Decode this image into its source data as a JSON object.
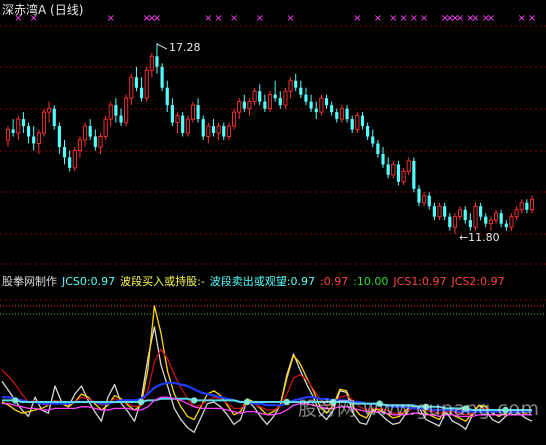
{
  "header": {
    "title": "深赤湾A (日线)"
  },
  "colors": {
    "background": "#000000",
    "grid": "#8b0000",
    "up_candle": "#ff3333",
    "down_candle": "#54ffff",
    "marker": "#ff40ff",
    "white_line": "#d8d8d8",
    "yellow_line": "#ffd400",
    "blue_line": "#1f3cff",
    "cyan_line": "#5ad8e8",
    "magenta_line": "#ff44ff",
    "red_line": "#c81414"
  },
  "indicator_bar": {
    "items": [
      {
        "text": "股拳网制作",
        "color": "#dcdcdc"
      },
      {
        "text": "JCS0:0.97",
        "color": "#54ffff"
      },
      {
        "text": "波段买入或持股:-",
        "color": "#ffff55"
      },
      {
        "text": "波段卖出或观望:0.97",
        "color": "#54ffff"
      },
      {
        "text": ":0.97",
        "color": "#ff4444"
      },
      {
        "text": ":10.00",
        "color": "#33dd33"
      },
      {
        "text": "JCS1:0.97",
        "color": "#ff4444"
      },
      {
        "text": "JCS2:0.97",
        "color": "#ff4444"
      }
    ]
  },
  "watermark": "股旁网 www.gupang.com",
  "chart_data": [
    {
      "type": "candlestick",
      "title": "深赤湾A (日线)",
      "annotations": [
        {
          "text": "17.28",
          "kind": "high"
        },
        {
          "text": "←11.80",
          "kind": "low"
        }
      ],
      "ylim": [
        11.0,
        18.0
      ],
      "candles": [
        [
          14.5,
          14.9,
          14.3,
          14.8
        ],
        [
          14.8,
          15.1,
          14.6,
          14.7
        ],
        [
          14.7,
          15.2,
          14.5,
          15.1
        ],
        [
          15.1,
          15.3,
          14.7,
          14.9
        ],
        [
          14.9,
          15.0,
          14.4,
          14.6
        ],
        [
          14.6,
          14.9,
          14.2,
          14.4
        ],
        [
          14.4,
          14.8,
          14.1,
          14.7
        ],
        [
          14.7,
          15.4,
          14.6,
          15.3
        ],
        [
          15.3,
          15.6,
          15.0,
          15.4
        ],
        [
          15.4,
          15.5,
          14.8,
          14.9
        ],
        [
          14.9,
          15.0,
          14.1,
          14.3
        ],
        [
          14.3,
          14.5,
          13.8,
          14.0
        ],
        [
          14.0,
          14.2,
          13.6,
          13.7
        ],
        [
          13.7,
          14.3,
          13.6,
          14.2
        ],
        [
          14.2,
          14.6,
          14.0,
          14.5
        ],
        [
          14.5,
          15.0,
          14.3,
          14.9
        ],
        [
          14.9,
          15.1,
          14.5,
          14.6
        ],
        [
          14.6,
          14.8,
          14.2,
          14.3
        ],
        [
          14.3,
          14.7,
          14.1,
          14.6
        ],
        [
          14.6,
          15.2,
          14.5,
          15.1
        ],
        [
          15.1,
          15.6,
          14.9,
          15.5
        ],
        [
          15.5,
          15.7,
          15.0,
          15.2
        ],
        [
          15.2,
          15.4,
          14.9,
          15.0
        ],
        [
          15.0,
          15.8,
          14.9,
          15.7
        ],
        [
          15.7,
          16.4,
          15.5,
          16.3
        ],
        [
          16.3,
          16.6,
          15.9,
          16.0
        ],
        [
          16.0,
          16.3,
          15.6,
          15.7
        ],
        [
          15.7,
          16.6,
          15.6,
          16.5
        ],
        [
          16.5,
          17.0,
          16.3,
          16.9
        ],
        [
          16.9,
          17.28,
          16.4,
          16.6
        ],
        [
          16.6,
          16.7,
          15.9,
          16.0
        ],
        [
          16.0,
          16.2,
          15.3,
          15.5
        ],
        [
          15.5,
          15.7,
          14.9,
          15.0
        ],
        [
          15.0,
          15.3,
          14.7,
          15.2
        ],
        [
          15.2,
          15.3,
          14.6,
          14.7
        ],
        [
          14.7,
          15.2,
          14.6,
          15.1
        ],
        [
          15.1,
          15.6,
          15.0,
          15.5
        ],
        [
          15.5,
          15.7,
          15.0,
          15.1
        ],
        [
          15.1,
          15.2,
          14.5,
          14.6
        ],
        [
          14.6,
          15.0,
          14.4,
          14.9
        ],
        [
          14.9,
          15.1,
          14.6,
          14.7
        ],
        [
          14.7,
          15.0,
          14.5,
          14.9
        ],
        [
          14.9,
          15.0,
          14.5,
          14.6
        ],
        [
          14.6,
          15.0,
          14.5,
          14.9
        ],
        [
          14.9,
          15.4,
          14.8,
          15.3
        ],
        [
          15.3,
          15.7,
          15.1,
          15.6
        ],
        [
          15.6,
          15.8,
          15.3,
          15.4
        ],
        [
          15.4,
          15.7,
          15.2,
          15.6
        ],
        [
          15.6,
          16.0,
          15.5,
          15.9
        ],
        [
          15.9,
          16.1,
          15.5,
          15.6
        ],
        [
          15.6,
          15.8,
          15.3,
          15.4
        ],
        [
          15.4,
          15.9,
          15.3,
          15.8
        ],
        [
          15.8,
          16.2,
          15.6,
          15.7
        ],
        [
          15.7,
          15.9,
          15.4,
          15.5
        ],
        [
          15.5,
          16.0,
          15.4,
          15.9
        ],
        [
          15.9,
          16.3,
          15.7,
          16.2
        ],
        [
          16.2,
          16.4,
          15.9,
          16.0
        ],
        [
          16.0,
          16.2,
          15.7,
          15.8
        ],
        [
          15.8,
          16.0,
          15.5,
          15.6
        ],
        [
          15.6,
          15.8,
          15.3,
          15.4
        ],
        [
          15.4,
          15.6,
          15.1,
          15.3
        ],
        [
          15.3,
          15.8,
          15.2,
          15.7
        ],
        [
          15.7,
          15.8,
          15.4,
          15.5
        ],
        [
          15.5,
          15.6,
          15.2,
          15.3
        ],
        [
          15.3,
          15.4,
          15.0,
          15.1
        ],
        [
          15.1,
          15.5,
          15.0,
          15.4
        ],
        [
          15.4,
          15.5,
          15.0,
          15.1
        ],
        [
          15.1,
          15.2,
          14.7,
          14.8
        ],
        [
          14.8,
          15.3,
          14.7,
          15.2
        ],
        [
          15.2,
          15.3,
          14.8,
          14.9
        ],
        [
          14.9,
          15.0,
          14.5,
          14.6
        ],
        [
          14.6,
          14.8,
          14.3,
          14.4
        ],
        [
          14.4,
          14.5,
          14.0,
          14.1
        ],
        [
          14.1,
          14.3,
          13.7,
          13.8
        ],
        [
          13.8,
          14.0,
          13.4,
          13.5
        ],
        [
          13.5,
          13.9,
          13.4,
          13.8
        ],
        [
          13.8,
          13.9,
          13.2,
          13.3
        ],
        [
          13.3,
          13.7,
          13.2,
          13.6
        ],
        [
          13.6,
          14.0,
          13.5,
          13.9
        ],
        [
          13.9,
          14.0,
          13.0,
          13.1
        ],
        [
          13.1,
          13.2,
          12.6,
          12.7
        ],
        [
          12.7,
          13.0,
          12.6,
          12.9
        ],
        [
          12.9,
          13.0,
          12.5,
          12.6
        ],
        [
          12.6,
          12.7,
          12.2,
          12.3
        ],
        [
          12.3,
          12.7,
          12.2,
          12.6
        ],
        [
          12.6,
          12.7,
          12.2,
          12.3
        ],
        [
          12.3,
          12.4,
          11.9,
          12.0
        ],
        [
          12.0,
          12.4,
          11.8,
          12.3
        ],
        [
          12.3,
          12.6,
          12.2,
          12.5
        ],
        [
          12.5,
          12.6,
          12.1,
          12.2
        ],
        [
          12.2,
          12.4,
          11.9,
          12.0
        ],
        [
          12.0,
          12.7,
          11.9,
          12.6
        ],
        [
          12.6,
          12.7,
          12.2,
          12.3
        ],
        [
          12.3,
          12.4,
          12.0,
          12.1
        ],
        [
          12.1,
          12.3,
          11.9,
          12.2
        ],
        [
          12.2,
          12.5,
          12.1,
          12.4
        ],
        [
          12.4,
          12.5,
          12.0,
          12.1
        ],
        [
          12.1,
          12.2,
          11.9,
          12.0
        ],
        [
          12.0,
          12.4,
          11.9,
          12.3
        ],
        [
          12.3,
          12.6,
          12.2,
          12.5
        ],
        [
          12.5,
          12.8,
          12.4,
          12.7
        ],
        [
          12.7,
          12.8,
          12.4,
          12.5
        ],
        [
          12.5,
          12.9,
          12.4,
          12.8
        ]
      ],
      "markers_at_index": [
        2,
        5,
        20,
        27,
        28,
        29,
        39,
        41,
        44,
        49,
        55,
        68,
        72,
        75,
        77,
        79,
        81,
        85,
        86,
        87,
        88,
        90,
        91,
        93,
        94,
        100,
        102
      ]
    },
    {
      "type": "line",
      "title": "JCS",
      "ylim": [
        0,
        10
      ],
      "dotted_levels": [
        8.5,
        8.0
      ],
      "series": [
        {
          "name": "JCS0",
          "color": "#d8d8d8",
          "values": [
            3.8,
            3.2,
            2.6,
            2.0,
            1.6,
            2.8,
            2.0,
            1.8,
            3.5,
            2.5,
            2.2,
            3.0,
            3.5,
            2.6,
            1.9,
            1.3,
            2.8,
            3.6,
            2.4,
            1.9,
            1.3,
            2.6,
            5.2,
            7.2,
            4.8,
            3.5,
            2.1,
            1.4,
            0.9,
            0.6,
            1.5,
            2.4,
            2.5,
            2.2,
            1.7,
            1.1,
            1.4,
            2.6,
            2.2,
            1.6,
            1.1,
            1.6,
            2.3,
            4.2,
            5.5,
            4.5,
            3.6,
            2.8,
            1.8,
            1.4,
            2.0,
            3.2,
            3.1,
            1.8,
            1.2,
            1.1,
            2.0,
            1.8,
            1.4,
            1.1,
            1.2,
            1.8,
            2.2,
            2.1,
            1.4,
            1.2,
            1.0,
            1.9,
            1.3,
            1.1,
            0.8,
            1.7,
            2.3,
            2.0,
            1.4,
            1.2,
            1.6,
            1.9,
            1.8,
            1.5,
            1.3
          ]
        },
        {
          "name": "JCS1",
          "color": "#ffd400",
          "values": [
            2.5,
            2.3,
            2.0,
            1.8,
            1.9,
            2.0,
            2.1,
            2.3,
            2.6,
            2.4,
            2.2,
            2.5,
            3.0,
            2.8,
            2.4,
            2.0,
            2.3,
            2.9,
            2.7,
            2.3,
            2.0,
            2.3,
            4.5,
            8.5,
            6.8,
            4.4,
            3.0,
            2.2,
            1.6,
            1.4,
            2.2,
            3.0,
            3.2,
            2.9,
            2.3,
            1.7,
            1.9,
            2.7,
            2.5,
            2.1,
            1.7,
            1.9,
            2.3,
            4.0,
            5.4,
            4.9,
            4.0,
            3.2,
            2.2,
            1.8,
            2.3,
            3.3,
            3.2,
            2.2,
            1.7,
            1.5,
            2.1,
            2.0,
            1.8,
            1.5,
            1.6,
            2.0,
            2.3,
            2.2,
            1.8,
            1.6,
            1.4,
            2.1,
            1.7,
            1.5,
            1.3,
            1.8,
            2.3,
            2.2,
            1.8,
            1.6,
            1.8,
            2.0,
            1.9,
            1.8,
            1.9
          ]
        },
        {
          "name": "JCS2",
          "color": "#c81414",
          "values": [
            4.5,
            4.1,
            3.6,
            3.0,
            2.5,
            2.6,
            2.4,
            2.3,
            2.6,
            2.5,
            2.4,
            2.5,
            2.8,
            2.7,
            2.5,
            2.3,
            2.4,
            2.7,
            2.6,
            2.4,
            2.2,
            2.3,
            3.2,
            5.0,
            5.8,
            5.2,
            4.2,
            3.4,
            2.7,
            2.2,
            2.3,
            2.6,
            2.8,
            2.7,
            2.4,
            2.1,
            2.1,
            2.4,
            2.4,
            2.2,
            2.0,
            2.0,
            2.2,
            3.0,
            4.0,
            4.2,
            3.9,
            3.3,
            2.7,
            2.3,
            2.4,
            2.8,
            2.9,
            2.6,
            2.2,
            2.0,
            2.1,
            2.1,
            2.0,
            1.8,
            1.8,
            1.9,
            2.1,
            2.1,
            2.0,
            1.9,
            1.8,
            1.9,
            1.9,
            1.8,
            1.7,
            1.8,
            2.0,
            2.1,
            2.0,
            1.9,
            1.9,
            2.0,
            2.0,
            1.9,
            1.9
          ]
        },
        {
          "name": "",
          "color": "#1f3cff",
          "values": [
            2.8,
            2.8,
            2.7,
            2.6,
            2.5,
            2.5,
            2.4,
            2.4,
            2.4,
            2.4,
            2.4,
            2.5,
            2.5,
            2.5,
            2.5,
            2.4,
            2.4,
            2.5,
            2.6,
            2.6,
            2.6,
            2.7,
            3.0,
            3.4,
            3.6,
            3.7,
            3.7,
            3.6,
            3.5,
            3.3,
            3.1,
            3.0,
            2.9,
            2.8,
            2.7,
            2.6,
            2.5,
            2.5,
            2.4,
            2.4,
            2.3,
            2.3,
            2.3,
            2.4,
            2.6,
            2.7,
            2.8,
            2.8,
            2.7,
            2.7,
            2.6,
            2.6,
            2.6,
            2.5,
            2.5,
            2.4,
            2.4,
            2.3,
            2.3,
            2.2,
            2.2,
            2.2,
            2.1,
            2.1,
            2.1,
            2.0,
            2.0,
            2.0,
            2.0,
            1.9,
            1.9,
            1.9,
            1.9,
            1.9,
            1.9,
            1.9,
            1.9,
            1.9,
            1.9,
            1.9,
            1.9
          ]
        },
        {
          "name": "",
          "color": "#5ad8e8",
          "values": [
            2.6,
            2.6,
            2.6,
            2.5,
            2.5,
            2.5,
            2.5,
            2.5,
            2.5,
            2.5,
            2.5,
            2.5,
            2.5,
            2.5,
            2.5,
            2.5,
            2.5,
            2.5,
            2.5,
            2.5,
            2.5,
            2.5,
            2.6,
            2.6,
            2.7,
            2.7,
            2.7,
            2.7,
            2.7,
            2.6,
            2.6,
            2.6,
            2.6,
            2.6,
            2.6,
            2.6,
            2.5,
            2.5,
            2.5,
            2.5,
            2.5,
            2.5,
            2.5,
            2.5,
            2.5,
            2.5,
            2.5,
            2.5,
            2.5,
            2.5,
            2.5,
            2.5,
            2.5,
            2.4,
            2.4,
            2.4,
            2.4,
            2.4,
            2.3,
            2.3,
            2.3,
            2.3,
            2.3,
            2.2,
            2.2,
            2.2,
            2.2,
            2.1,
            2.1,
            2.1,
            2.1,
            2.0,
            2.0,
            2.0,
            2.0,
            2.0,
            2.0,
            2.0,
            2.0,
            2.0,
            2.0
          ]
        },
        {
          "name": "",
          "color": "#ff44ff",
          "values": [
            2.4,
            2.4,
            2.3,
            2.2,
            2.1,
            2.1,
            2.0,
            2.0,
            2.1,
            2.1,
            2.1,
            2.1,
            2.2,
            2.2,
            2.1,
            2.0,
            2.0,
            2.1,
            2.1,
            2.1,
            2.0,
            2.0,
            2.2,
            2.6,
            2.8,
            2.8,
            2.7,
            2.6,
            2.4,
            2.2,
            2.1,
            2.1,
            2.1,
            2.1,
            2.0,
            1.9,
            1.8,
            1.9,
            1.9,
            1.8,
            1.7,
            1.7,
            1.8,
            2.0,
            2.3,
            2.4,
            2.4,
            2.3,
            2.2,
            2.1,
            2.1,
            2.2,
            2.2,
            2.1,
            2.0,
            1.9,
            1.9,
            1.9,
            1.8,
            1.7,
            1.7,
            1.7,
            1.8,
            1.8,
            1.7,
            1.7,
            1.6,
            1.7,
            1.7,
            1.6,
            1.6,
            1.6,
            1.7,
            1.7,
            1.7,
            1.7,
            1.7,
            1.7,
            1.7,
            1.7,
            1.7
          ]
        }
      ],
      "signal_dots_at_index": [
        2,
        21,
        29,
        37,
        43,
        50,
        57,
        64,
        70,
        76
      ]
    }
  ]
}
